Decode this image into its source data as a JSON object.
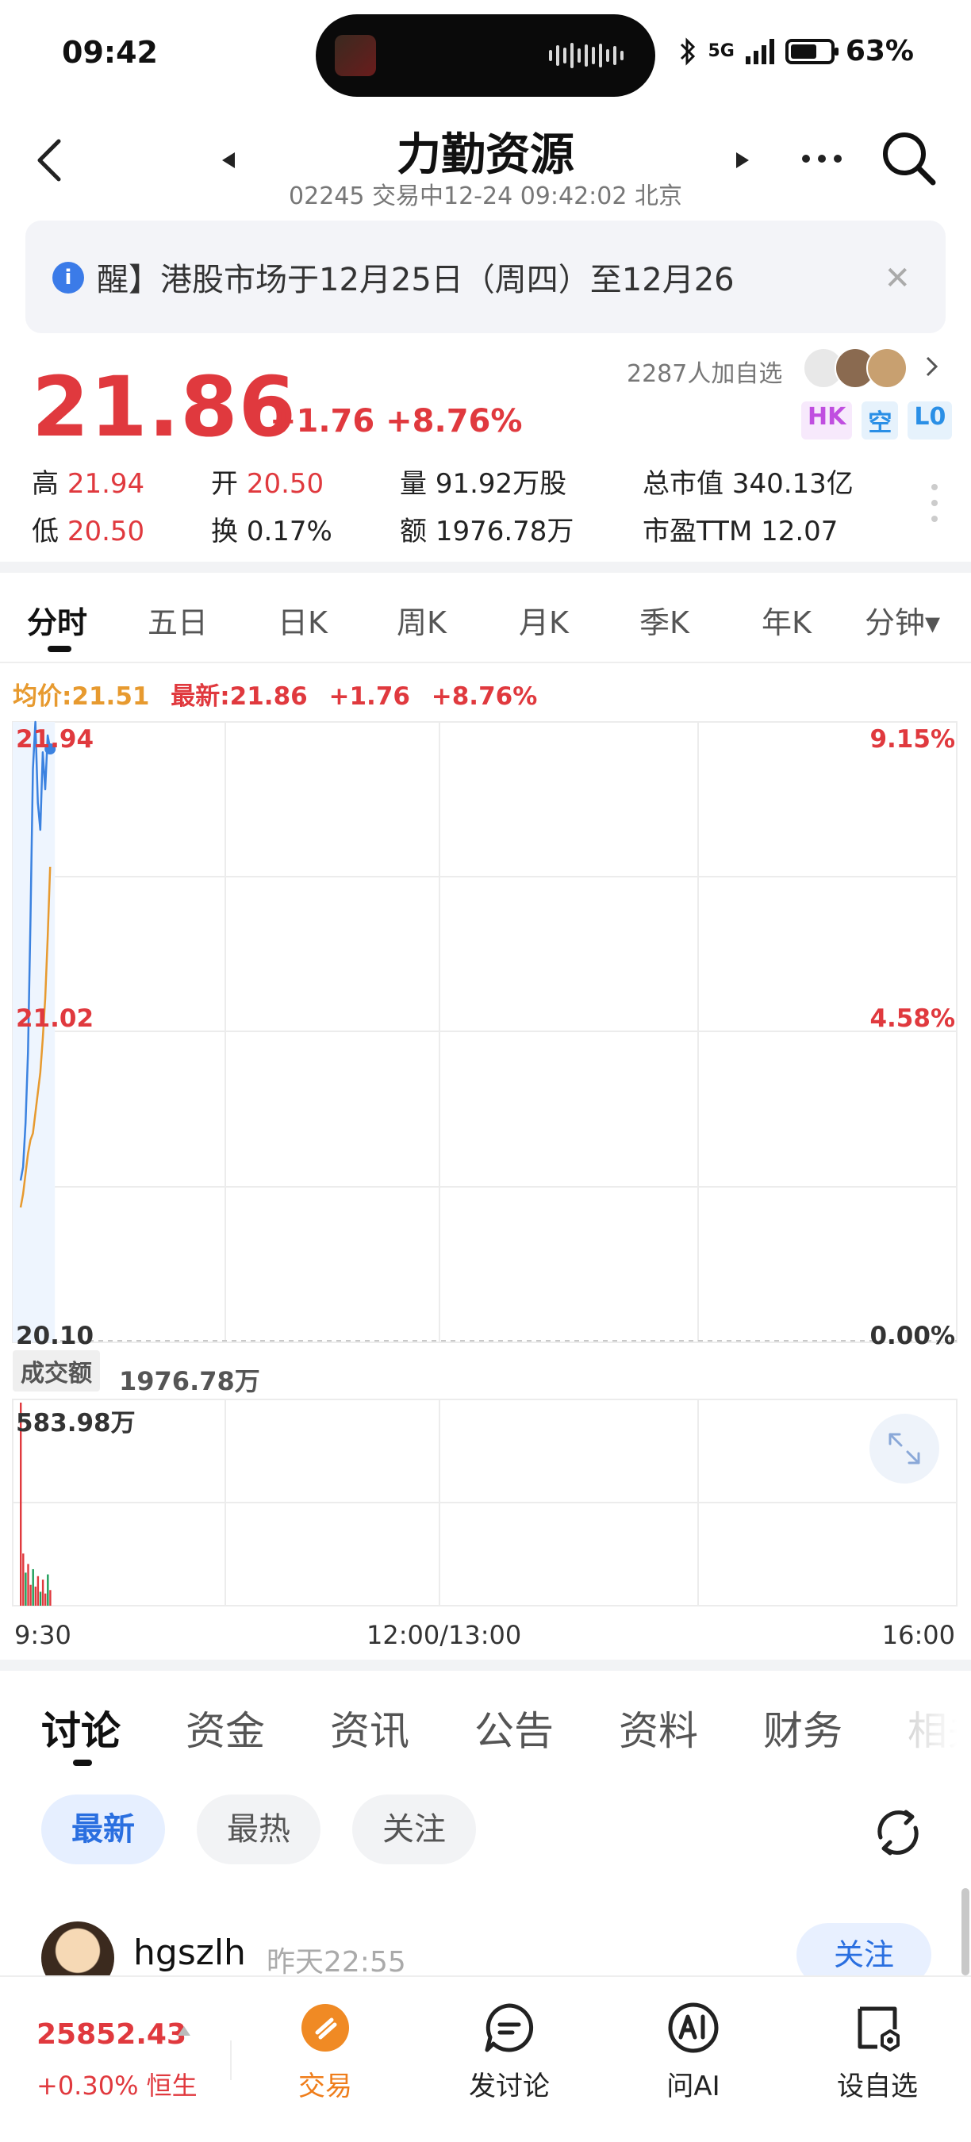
{
  "status_bar": {
    "time": "09:42",
    "battery": "63%",
    "network": "5G"
  },
  "header": {
    "title": "力勤资源",
    "subtitle": "02245 交易中12-24 09:42:02 北京"
  },
  "notice": {
    "text": "醒】港股市场于12月25日（周四）至12月26"
  },
  "quote": {
    "price": "21.86",
    "change": "+1.76",
    "change_pct": "+8.76%",
    "follow_count": "2287人加自选",
    "tags": [
      "HK",
      "空",
      "L0"
    ],
    "high_label": "高",
    "high": "21.94",
    "low_label": "低",
    "low": "20.50",
    "open_label": "开",
    "open": "20.50",
    "turnover_label": "换",
    "turnover": "0.17%",
    "volume_label": "量",
    "volume": "91.92万股",
    "amount_label": "额",
    "amount": "1976.78万",
    "mcap_label": "总市值",
    "mcap": "340.13亿",
    "pe_label": "市盈TTM",
    "pe": "12.07"
  },
  "period_tabs": [
    "分时",
    "五日",
    "日K",
    "周K",
    "月K",
    "季K",
    "年K",
    "分钟▾"
  ],
  "chart_legend": {
    "avg": "均价:21.51",
    "last": "最新:21.86",
    "change": "+1.76",
    "change_pct": "+8.76%"
  },
  "chart_data": {
    "type": "line",
    "y_labels_left": [
      "21.94",
      "21.02",
      "20.10"
    ],
    "y_labels_right": [
      "9.15%",
      "4.58%",
      "0.00%"
    ],
    "ylim": [
      20.1,
      21.94
    ],
    "x_labels": [
      "9:30",
      "12:00/13:00",
      "16:00"
    ],
    "series": [
      {
        "name": "最新",
        "color": "#3b82e0",
        "values": [
          20.58,
          20.62,
          20.75,
          20.96,
          21.35,
          21.8,
          21.94,
          21.7,
          21.62,
          21.85,
          21.74,
          21.9,
          21.86
        ]
      },
      {
        "name": "均价",
        "color": "#e79a2f",
        "values": [
          20.5,
          20.54,
          20.6,
          20.66,
          20.7,
          20.72,
          20.78,
          20.84,
          20.9,
          21.0,
          21.12,
          21.3,
          21.51
        ]
      }
    ],
    "volume": {
      "label": "成交额",
      "total": "1976.78万",
      "max_label": "583.98万",
      "values": [
        583.98,
        150,
        95,
        120,
        60,
        105,
        55,
        85,
        40,
        75,
        35,
        90,
        45
      ]
    }
  },
  "content_tabs": [
    "讨论",
    "资金",
    "资讯",
    "公告",
    "资料",
    "财务",
    "相关"
  ],
  "filter_chips": [
    "最新",
    "最热",
    "关注"
  ],
  "post": {
    "user": "hgszlh",
    "time": "昨天22:55",
    "follow": "关注"
  },
  "bottom_bar": {
    "index_value": "25852.43",
    "index_change": "+0.30% 恒生",
    "items": [
      "交易",
      "发讨论",
      "问AI",
      "设自选"
    ]
  },
  "colors": {
    "up": "#e0393e",
    "avg_line": "#e79a2f",
    "price_line": "#3b82e0",
    "accent_orange": "#ef7d1a",
    "accent_blue": "#2a6fe0"
  }
}
